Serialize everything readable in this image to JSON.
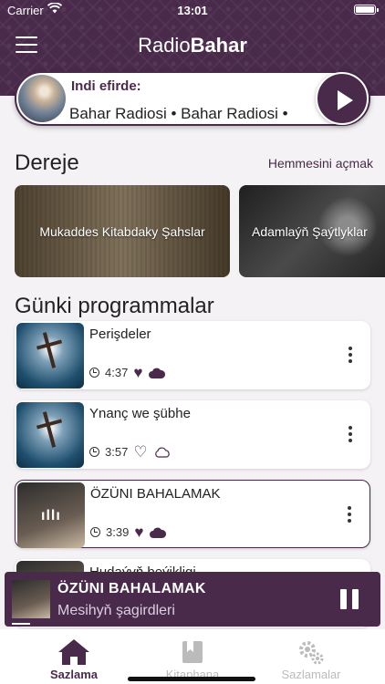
{
  "status_bar": {
    "carrier": "Carrier",
    "time": "13:01"
  },
  "header": {
    "brand_light": "Radio",
    "brand_bold": "Bahar"
  },
  "now_playing": {
    "label": "Indi efirde:",
    "marquee": "Bahar Radiosi • Bahar Radiosi • "
  },
  "categories": {
    "title": "Dereje",
    "see_all": "Hemmesini açmak",
    "items": [
      {
        "label": "Mukaddes Kitabdaky Şahslar"
      },
      {
        "label": "Adamlaýň Şaýtlyklar"
      }
    ]
  },
  "programs": {
    "title": "Günki programmalar",
    "items": [
      {
        "title": "Perişdeler",
        "duration": "4:37",
        "favorited": true,
        "downloaded": true,
        "active": false
      },
      {
        "title": "Ynanç we şübhe",
        "duration": "3:57",
        "favorited": false,
        "downloaded": false,
        "active": false
      },
      {
        "title": "ÖZÜNI BAHALAMAK",
        "duration": "3:39",
        "favorited": true,
        "downloaded": true,
        "active": true
      },
      {
        "title": "Hudaýyň beýikligi"
      }
    ]
  },
  "mini_player": {
    "title": "ÖZÜNI BAHALAMAK",
    "subtitle": "Mesihyň şagirdleri"
  },
  "tabs": [
    {
      "label": "Sazlama",
      "icon": "home-icon",
      "active": true
    },
    {
      "label": "Kitaphana",
      "icon": "library-icon",
      "active": false
    },
    {
      "label": "Sazlamalar",
      "icon": "settings-gears-icon",
      "active": false
    }
  ],
  "colors": {
    "accent": "#4a2a4b",
    "background": "#f4f2f4",
    "inactive_tab": "#bbbbbb"
  }
}
